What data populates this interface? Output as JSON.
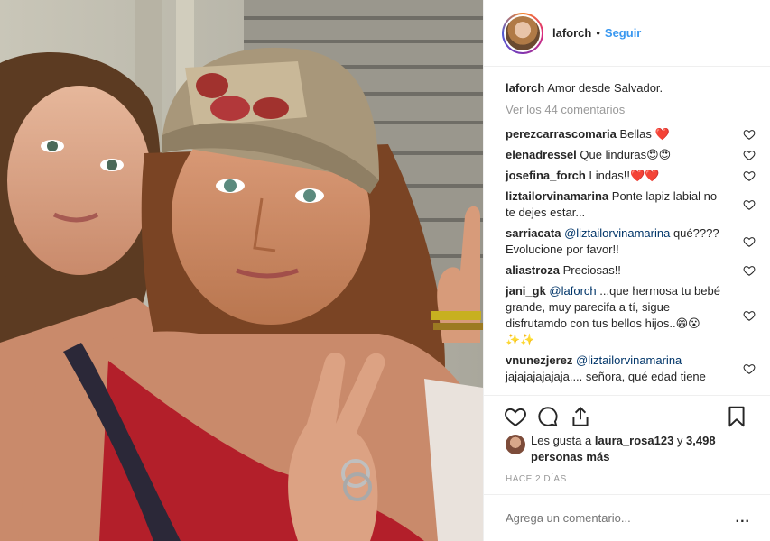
{
  "post": {
    "username": "laforch",
    "follow_label": "Seguir",
    "separator": "•",
    "caption_user": "laforch",
    "caption_text": "Amor desde Salvador.",
    "view_all": "Ver los 44 comentarios"
  },
  "comments": [
    {
      "user": "perezcarrascomaria",
      "mention": "",
      "text": "Bellas ❤️"
    },
    {
      "user": "elenadressel",
      "mention": "",
      "text": "Que linduras😍😍"
    },
    {
      "user": "josefina_forch",
      "mention": "",
      "text": "Lindas!!❤️❤️"
    },
    {
      "user": "liztailorvinamarina",
      "mention": "",
      "text": "Ponte lapiz labial no te dejes estar..."
    },
    {
      "user": "sarriacata",
      "mention": "@liztailorvinamarina",
      "text": "qué???? Evolucione por favor!!"
    },
    {
      "user": "aliastroza",
      "mention": "",
      "text": "Preciosas!!"
    },
    {
      "user": "jani_gk",
      "mention": "@laforch",
      "text": "...que hermosa tu bebé grande, muy parecifa a tí, sigue disfrutamdo con tus bellos hijos..😁😮 ✨✨"
    },
    {
      "user": "vnunezjerez",
      "mention": "@liztailorvinamarina",
      "text": "jajajajajajaja.... señora, qué edad tiene"
    }
  ],
  "likes": {
    "prefix": "Les gusta a",
    "user": "laura_rosa123",
    "suffix": "y",
    "count": "3,498 personas más"
  },
  "time": "HACE 2 DÍAS",
  "add_comment": {
    "placeholder": "Agrega un comentario..."
  },
  "more_label": "...",
  "colors": {
    "link": "#3897f0",
    "muted": "#999999",
    "border": "#efefef",
    "mention": "#003569"
  },
  "icons": [
    "heart-icon",
    "comment-icon",
    "share-icon",
    "bookmark-icon",
    "more-options-icon"
  ]
}
